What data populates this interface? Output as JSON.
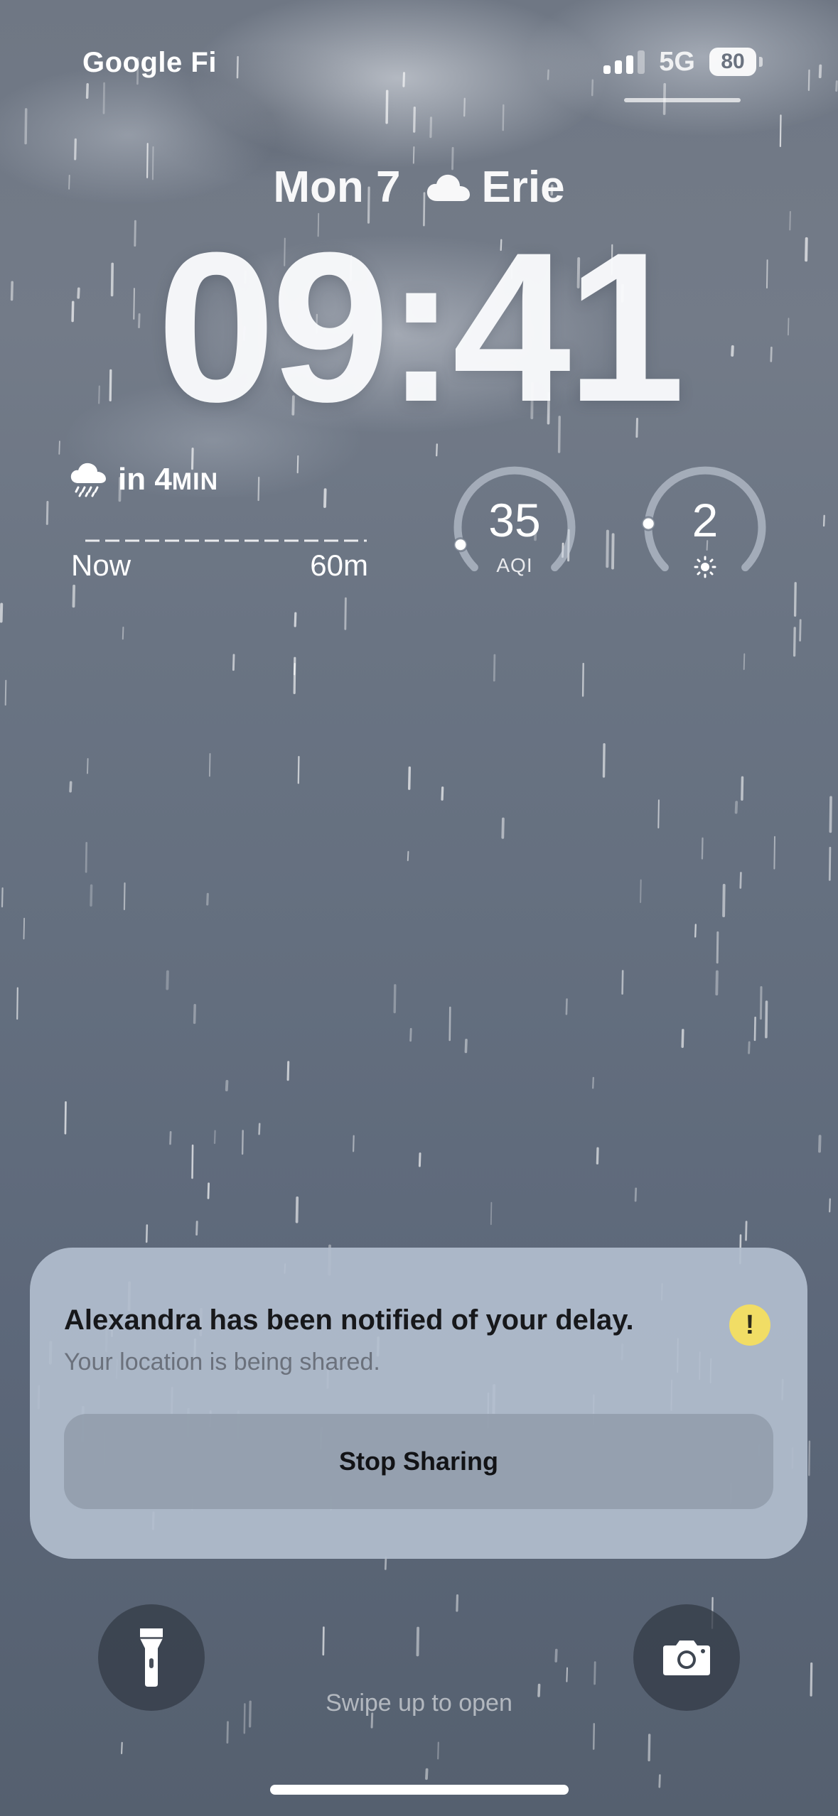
{
  "status_bar": {
    "carrier": "Google Fi",
    "network": "5G",
    "battery": "80",
    "signal_bars": 3,
    "signal_bars_total": 4
  },
  "lock_screen": {
    "date": "Mon 7",
    "weather_icon": "cloud-icon",
    "location": "Erie",
    "time": "09:41"
  },
  "widgets": {
    "rain": {
      "icon": "cloud-rain-icon",
      "prefix": "in 4",
      "unit": "MIN",
      "start_label": "Now",
      "end_label": "60m"
    },
    "aqi": {
      "value": "35",
      "label": "AQI",
      "level_fraction": 0.1
    },
    "uv": {
      "value": "2",
      "icon": "sun-icon",
      "level_fraction": 0.18
    }
  },
  "notification": {
    "title": "Alexandra has been notified of your delay.",
    "subtitle": "Your location is being shared.",
    "alert_icon": "!",
    "action_label": "Stop Sharing",
    "alert_color": "#F1DD65"
  },
  "bottom": {
    "flashlight_icon": "flashlight-icon",
    "camera_icon": "camera-icon",
    "swipe_hint": "Swipe up to open"
  }
}
